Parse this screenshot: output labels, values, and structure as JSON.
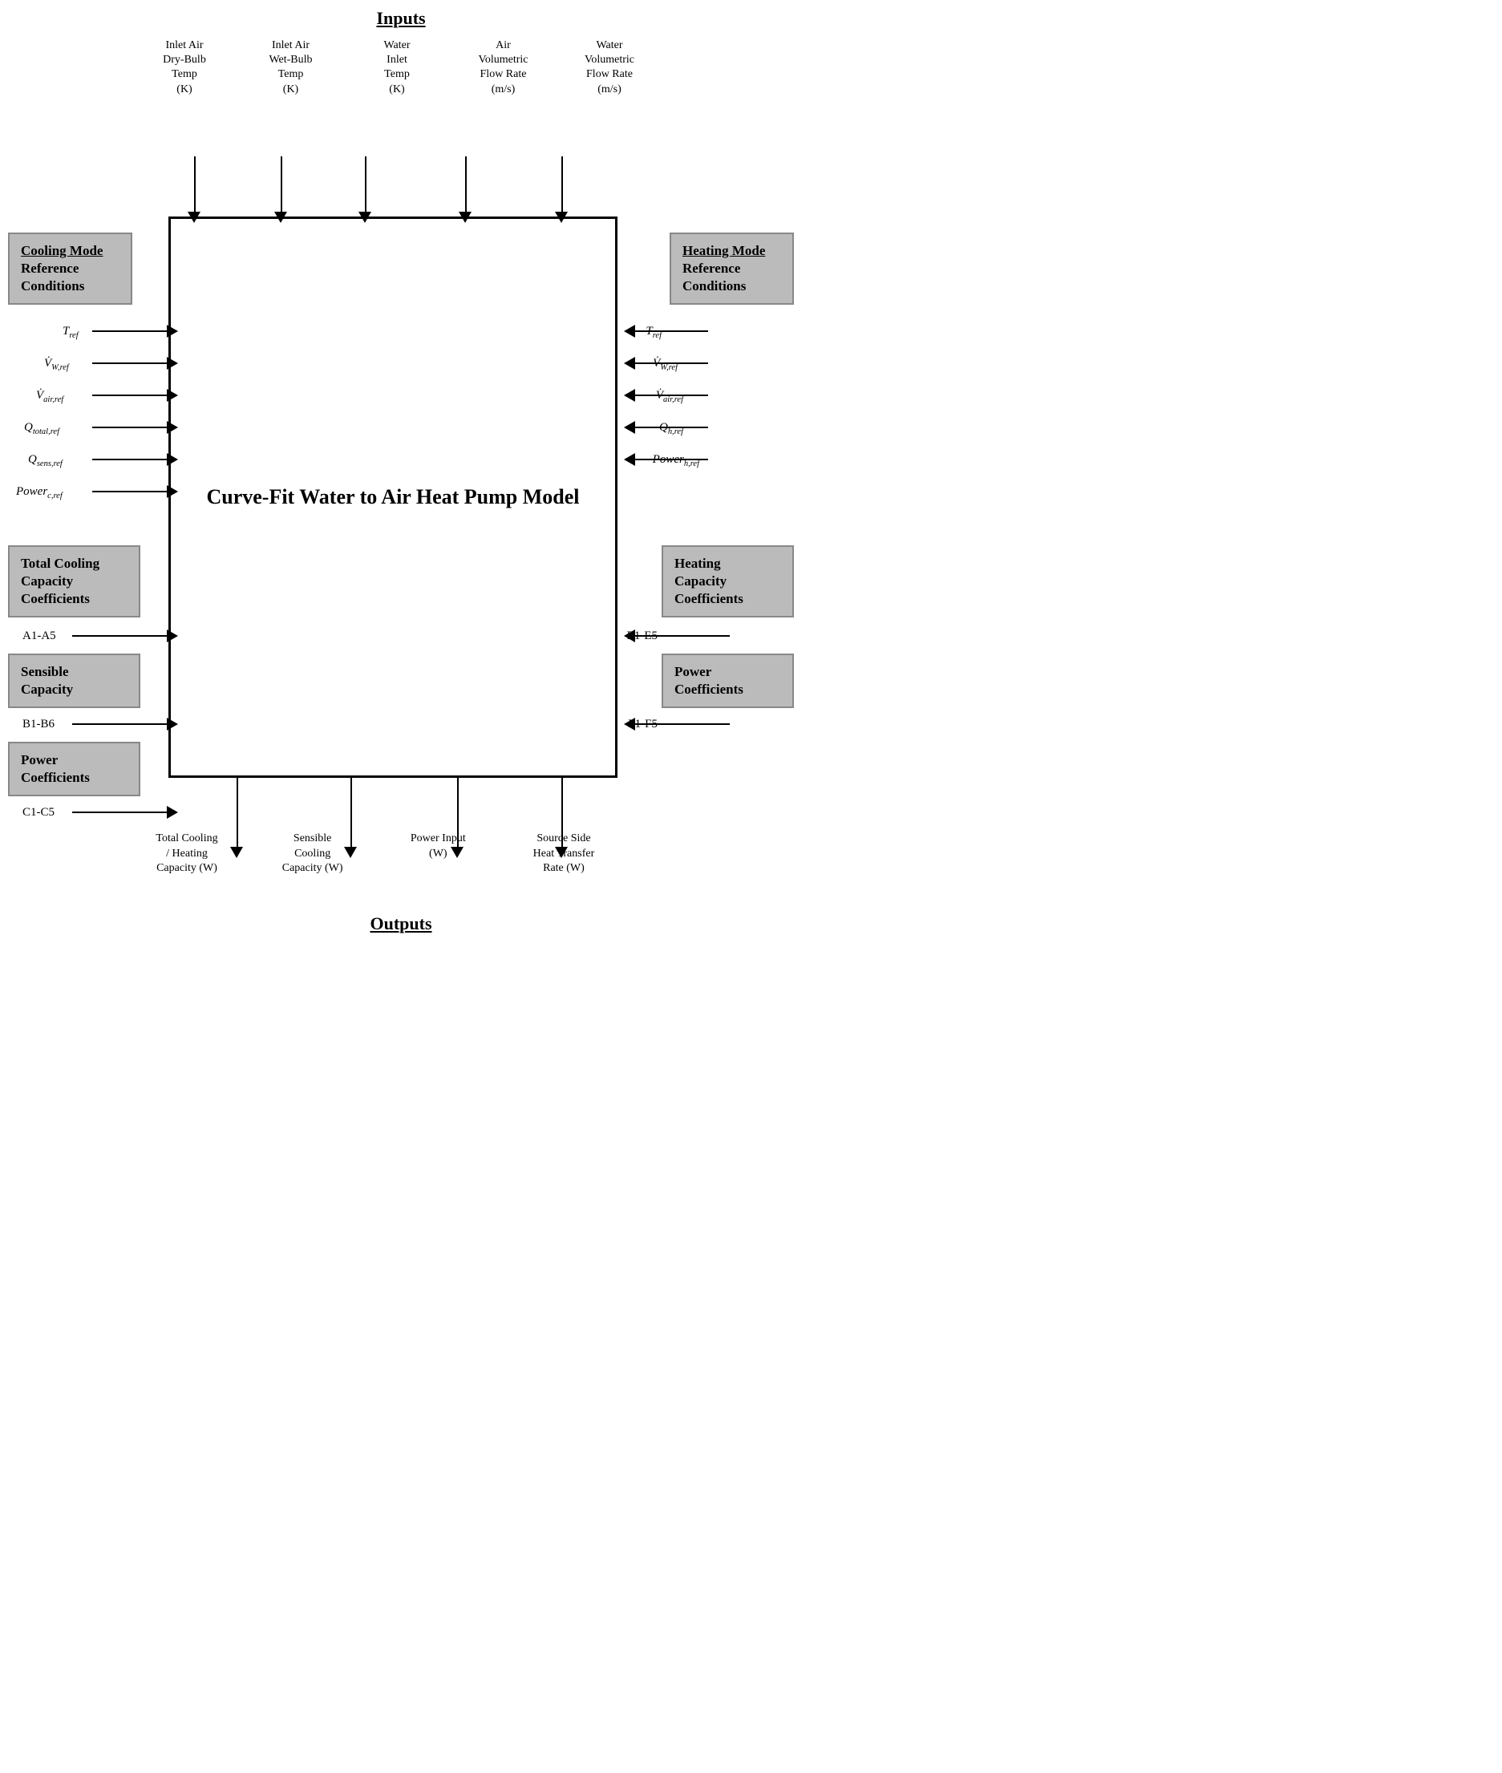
{
  "title": "Curve-Fit Water to Air Heat Pump Model",
  "inputs_label": "Inputs",
  "outputs_label": "Outputs",
  "top_headers": [
    {
      "label": "Inlet Air\nDry-Bulb\nTemp\n(K)"
    },
    {
      "label": "Inlet Air\nWet-Bulb\nTemp\n(K)"
    },
    {
      "label": "Water\nInlet\nTemp\n(K)"
    },
    {
      "label": "Air\nVolumetric\nFlow Rate\n(m/s)"
    },
    {
      "label": "Water\nVolumetric\nFlow Rate\n(m/s)"
    }
  ],
  "bottom_headers": [
    {
      "label": "Total Cooling\n/ Heating\nCapacity (W)"
    },
    {
      "label": "Sensible\nCooling\nCapacity (W)"
    },
    {
      "label": "Power Input\n(W)"
    },
    {
      "label": "Source Side\nHeat Transfer\nRate (W)"
    }
  ],
  "left_side": {
    "mode_label": "Cooling Mode",
    "reference_label": "Reference\nConditions",
    "refs": [
      "T_ref",
      "V̇_{W,ref}",
      "V̇_{air,ref}",
      "Q_{total,ref}",
      "Q_{sens,ref}",
      "Power_{c,ref}"
    ],
    "boxes": [
      {
        "label": "Total Cooling\nCapacity\nCoefficients"
      },
      {
        "label": "Sensible\nCapacity"
      },
      {
        "label": "Power\nCoefficients"
      }
    ],
    "coeffs": [
      "A1-A5",
      "B1-B6",
      "C1-C5"
    ]
  },
  "right_side": {
    "mode_label": "Heating Mode",
    "reference_label": "Reference\nConditions",
    "refs": [
      "T_ref",
      "V̇_{W,ref}",
      "V̇_{air,ref}",
      "Q_{h,ref}",
      "Power_{h,ref}"
    ],
    "boxes": [
      {
        "label": "Heating\nCapacity\nCoefficients"
      },
      {
        "label": "Power\nCoefficients"
      }
    ],
    "coeffs": [
      "E1-E5",
      "F1-F5"
    ]
  }
}
